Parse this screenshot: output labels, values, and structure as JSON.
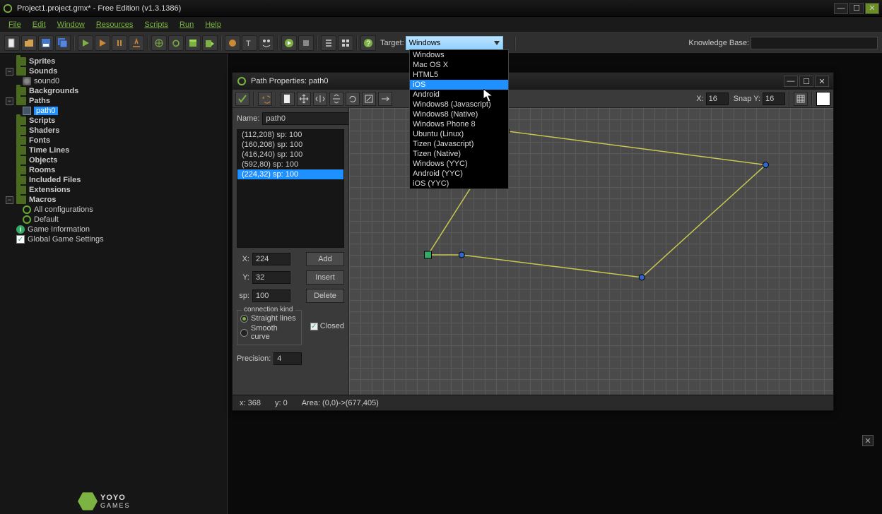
{
  "app": {
    "title": "Project1.project.gmx* - Free Edition (v1.3.1386)"
  },
  "menu": {
    "file": "File",
    "edit": "Edit",
    "window": "Window",
    "resources": "Resources",
    "scripts": "Scripts",
    "run": "Run",
    "help": "Help"
  },
  "toolbar": {
    "target_label": "Target:",
    "target_value": "Windows",
    "kb_label": "Knowledge Base:"
  },
  "target_options": [
    "Windows",
    "Mac OS X",
    "HTML5",
    "iOS",
    "Android",
    "Windows8 (Javascript)",
    "Windows8 (Native)",
    "Windows Phone 8",
    "Ubuntu (Linux)",
    "Tizen (Javascript)",
    "Tizen (Native)",
    "Windows (YYC)",
    "Android (YYC)",
    "iOS (YYC)"
  ],
  "target_hover_index": 3,
  "tree": {
    "sprites": "Sprites",
    "sounds": "Sounds",
    "sound0": "sound0",
    "backgrounds": "Backgrounds",
    "paths": "Paths",
    "path0": "path0",
    "scripts": "Scripts",
    "shaders": "Shaders",
    "fonts": "Fonts",
    "timelines": "Time Lines",
    "objects": "Objects",
    "rooms": "Rooms",
    "included": "Included Files",
    "extensions": "Extensions",
    "macros": "Macros",
    "allconfig": "All configurations",
    "default": "Default",
    "gameinfo": "Game Information",
    "globalsettings": "Global Game Settings"
  },
  "yoyo": {
    "brand1": "YOYO",
    "brand2": "GAMES"
  },
  "path_window": {
    "title": "Path Properties: path0",
    "name_label": "Name:",
    "name_value": "path0",
    "points": [
      "(112,208)   sp: 100",
      "(160,208)   sp: 100",
      "(416,240)   sp: 100",
      "(592,80)   sp: 100",
      "(224,32)   sp: 100"
    ],
    "selected_point": 4,
    "x_label": "X:",
    "x_value": "224",
    "y_label": "Y:",
    "y_value": "32",
    "sp_label": "sp:",
    "sp_value": "100",
    "add_btn": "Add",
    "insert_btn": "Insert",
    "delete_btn": "Delete",
    "conn_legend": "connection kind",
    "straight": "Straight lines",
    "smooth": "Smooth curve",
    "closed": "Closed",
    "precision_label": "Precision:",
    "precision_value": "4",
    "snapx_label": "X:",
    "snapx_value": "16",
    "snapy_label": "Snap Y:",
    "snapy_value": "16",
    "status_x": "x: 368",
    "status_y": "y: 0",
    "status_area": "Area: (0,0)->(677,405)"
  }
}
